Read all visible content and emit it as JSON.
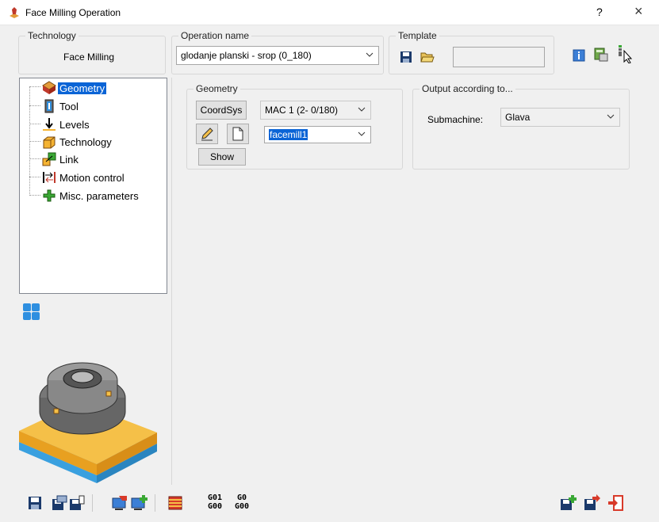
{
  "window": {
    "title": "Face Milling Operation",
    "help_label": "?",
    "close_label": "×"
  },
  "technology": {
    "legend": "Technology",
    "value": "Face Milling"
  },
  "operation_name": {
    "legend": "Operation name",
    "value": "glodanje planski - srop (0_180)"
  },
  "template": {
    "legend": "Template",
    "value": ""
  },
  "tree": {
    "items": [
      {
        "label": "Geometry",
        "icon": "geometry-icon",
        "selected": true
      },
      {
        "label": "Tool",
        "icon": "tool-icon"
      },
      {
        "label": "Levels",
        "icon": "levels-icon"
      },
      {
        "label": "Technology",
        "icon": "technology-icon"
      },
      {
        "label": "Link",
        "icon": "link-icon"
      },
      {
        "label": "Motion control",
        "icon": "motion-control-icon"
      },
      {
        "label": "Misc. parameters",
        "icon": "misc-parameters-icon"
      }
    ]
  },
  "geometry": {
    "legend": "Geometry",
    "coordsys_label": "CoordSys",
    "coordsys_value": "MAC 1 (2- 0/180)",
    "geometry_value": "facemill1",
    "show_label": "Show"
  },
  "output": {
    "legend": "Output according to...",
    "submachine_label": "Submachine:",
    "submachine_value": "Glava"
  },
  "bottom_toolbar": {
    "gcode_top_1": "G01",
    "gcode_bottom_1": "G00",
    "gcode_top_2": "G0",
    "gcode_bottom_2": "G00"
  },
  "colors": {
    "selection": "#0a64d6",
    "accent_orange": "#f5b332",
    "accent_blue": "#2e8fe0",
    "accent_green": "#3aa835",
    "accent_red": "#d83a2a"
  }
}
